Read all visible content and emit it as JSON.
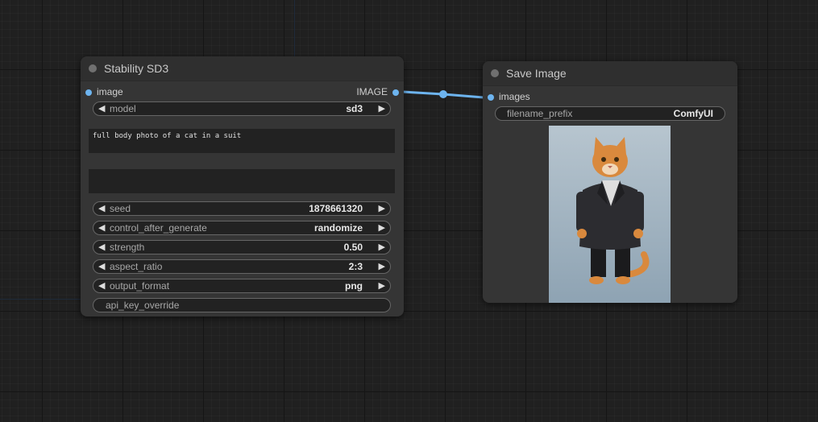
{
  "nodes": {
    "stability": {
      "title": "Stability SD3",
      "input_slot": "image",
      "output_slot": "IMAGE",
      "widgets": {
        "model": {
          "label": "model",
          "value": "sd3"
        },
        "seed": {
          "label": "seed",
          "value": "1878661320"
        },
        "control_after_generate": {
          "label": "control_after_generate",
          "value": "randomize"
        },
        "strength": {
          "label": "strength",
          "value": "0.50"
        },
        "aspect_ratio": {
          "label": "aspect_ratio",
          "value": "2:3"
        },
        "output_format": {
          "label": "output_format",
          "value": "png"
        },
        "api_key_override": {
          "label": "api_key_override"
        }
      },
      "prompt": "full body photo of a cat in a suit",
      "negative_prompt": ""
    },
    "save_image": {
      "title": "Save Image",
      "input_slot": "images",
      "widgets": {
        "filename_prefix": {
          "label": "filename_prefix",
          "value": "ComfyUI"
        }
      },
      "preview_image": "orange tabby cat standing upright wearing a dark tweed suit and black trousers"
    }
  },
  "colors": {
    "link": "#6db4ef",
    "node_bg": "#353535",
    "canvas_bg": "#202020"
  },
  "icons": {
    "left_arrow": "◀",
    "right_arrow": "▶"
  }
}
